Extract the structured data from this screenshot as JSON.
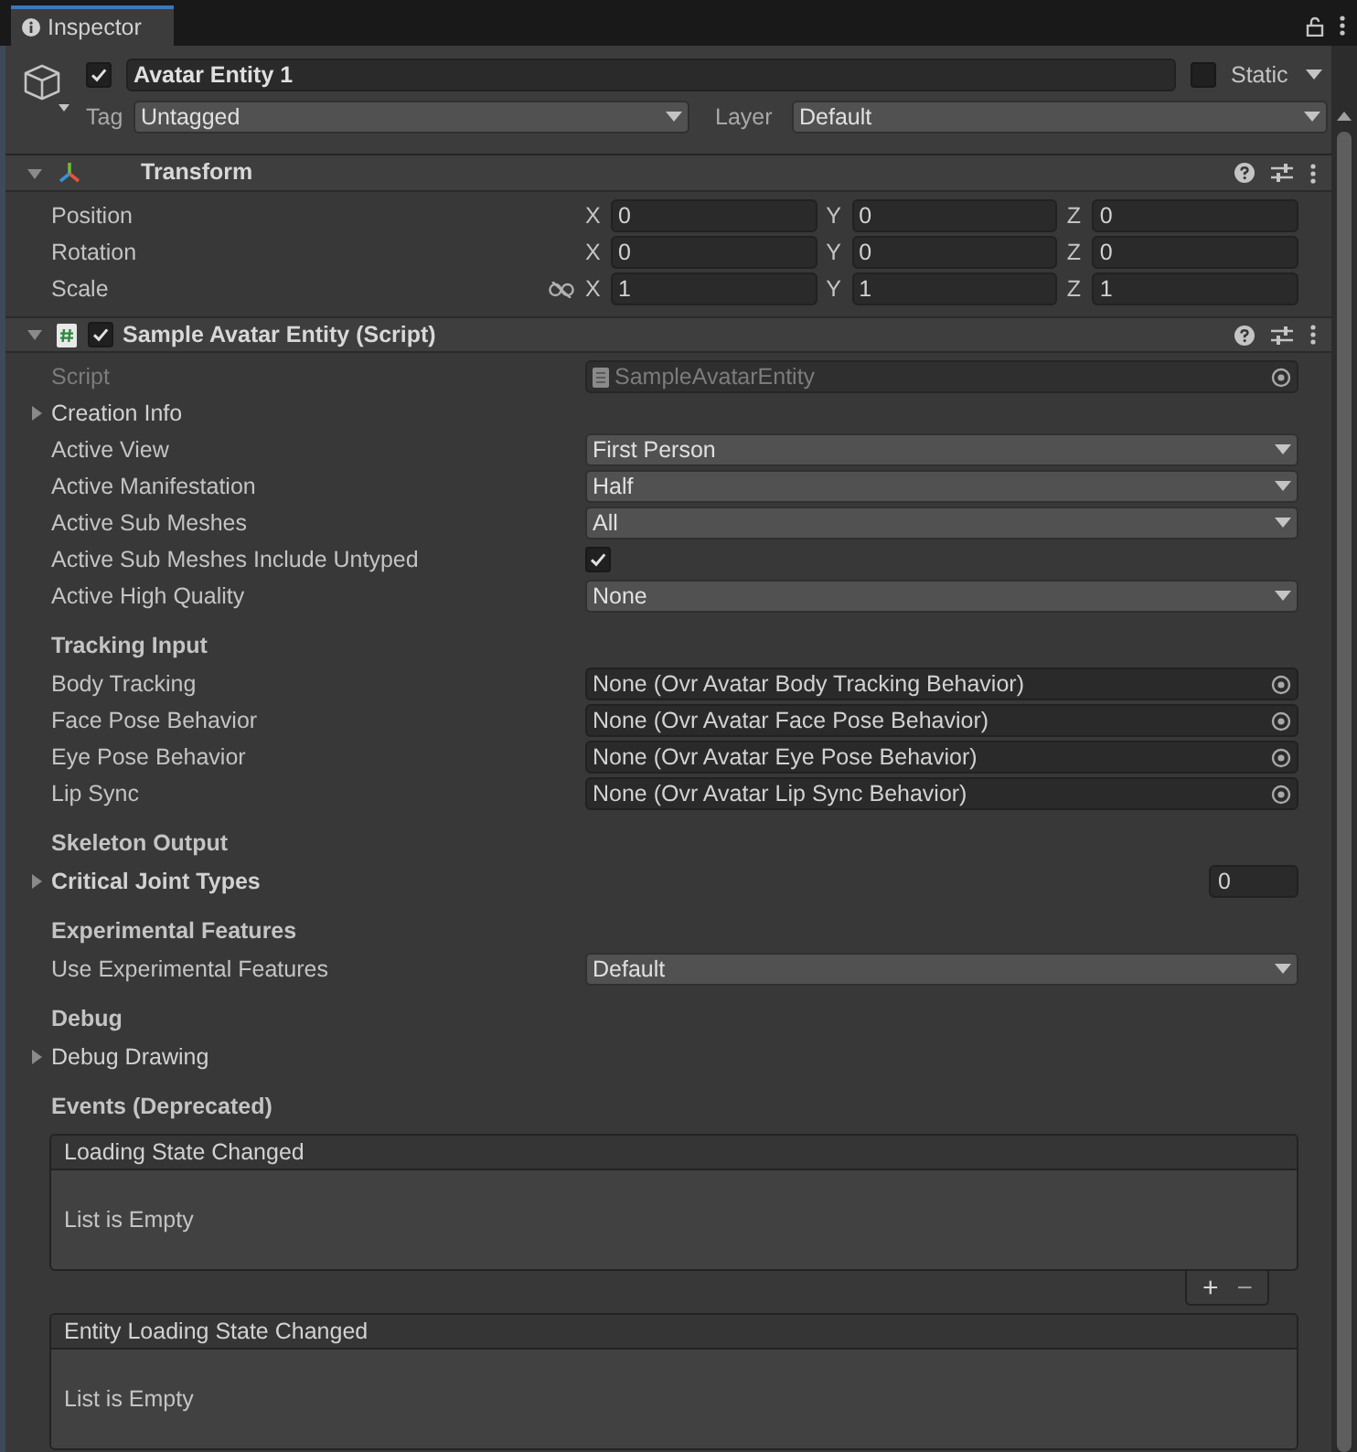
{
  "window": {
    "title": "Inspector"
  },
  "object": {
    "name": "Avatar Entity 1",
    "active": true,
    "static": false,
    "static_label": "Static",
    "tag_label": "Tag",
    "tag": "Untagged",
    "layer_label": "Layer",
    "layer": "Default"
  },
  "transform": {
    "title": "Transform",
    "expanded": true,
    "rows": [
      {
        "label": "Position",
        "linked": false,
        "fields": [
          {
            "axis": "X",
            "value": "0"
          },
          {
            "axis": "Y",
            "value": "0"
          },
          {
            "axis": "Z",
            "value": "0"
          }
        ]
      },
      {
        "label": "Rotation",
        "linked": false,
        "fields": [
          {
            "axis": "X",
            "value": "0"
          },
          {
            "axis": "Y",
            "value": "0"
          },
          {
            "axis": "Z",
            "value": "0"
          }
        ]
      },
      {
        "label": "Scale",
        "linked": true,
        "fields": [
          {
            "axis": "X",
            "value": "1"
          },
          {
            "axis": "Y",
            "value": "1"
          },
          {
            "axis": "Z",
            "value": "1"
          }
        ]
      }
    ]
  },
  "script_component": {
    "title": "Sample Avatar Entity (Script)",
    "enabled": true,
    "expanded": true,
    "properties": [
      {
        "kind": "script",
        "label": "Script",
        "value": "SampleAvatarEntity",
        "disabled": true
      },
      {
        "kind": "foldout",
        "label": "Creation Info",
        "expanded": false
      },
      {
        "kind": "dropdown",
        "label": "Active View",
        "value": "First Person"
      },
      {
        "kind": "dropdown",
        "label": "Active Manifestation",
        "value": "Half"
      },
      {
        "kind": "dropdown",
        "label": "Active Sub Meshes",
        "value": "All"
      },
      {
        "kind": "checkbox",
        "label": "Active Sub Meshes Include Untyped",
        "checked": true
      },
      {
        "kind": "dropdown",
        "label": "Active High Quality",
        "value": "None"
      },
      {
        "kind": "header",
        "label": "Tracking Input"
      },
      {
        "kind": "object",
        "label": "Body Tracking",
        "value": "None (Ovr Avatar Body Tracking Behavior)"
      },
      {
        "kind": "object",
        "label": "Face Pose Behavior",
        "value": "None (Ovr Avatar Face Pose Behavior)"
      },
      {
        "kind": "object",
        "label": "Eye Pose Behavior",
        "value": "None (Ovr Avatar Eye Pose Behavior)"
      },
      {
        "kind": "object",
        "label": "Lip Sync",
        "value": "None (Ovr Avatar Lip Sync Behavior)"
      },
      {
        "kind": "header",
        "label": "Skeleton Output"
      },
      {
        "kind": "array",
        "label": "Critical Joint Types",
        "expanded": false,
        "value": "0"
      },
      {
        "kind": "header",
        "label": "Experimental Features"
      },
      {
        "kind": "dropdown",
        "label": "Use Experimental Features",
        "value": "Default"
      },
      {
        "kind": "header",
        "label": "Debug"
      },
      {
        "kind": "foldout",
        "label": "Debug Drawing",
        "expanded": false
      },
      {
        "kind": "header",
        "label": "Events (Deprecated)"
      },
      {
        "kind": "event",
        "label": "Loading State Changed",
        "empty_text": "List is Empty",
        "add": "+",
        "remove": "−"
      },
      {
        "kind": "event",
        "label": "Entity Loading State Changed",
        "empty_text": "List is Empty"
      }
    ]
  }
}
